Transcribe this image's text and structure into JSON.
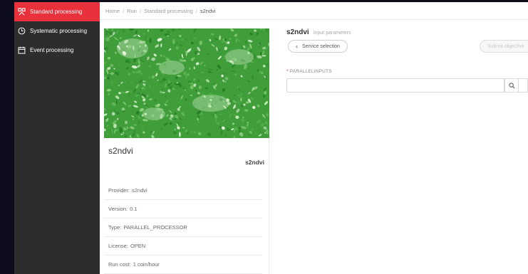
{
  "sidebar": {
    "items": [
      {
        "label": "Standard processing",
        "icon": "standard-processing-icon",
        "active": true
      },
      {
        "label": "Systematic processing",
        "icon": "clock-icon",
        "active": false
      },
      {
        "label": "Event processing",
        "icon": "calendar-icon",
        "active": false
      }
    ],
    "active_color": "#e8313b"
  },
  "breadcrumb": [
    "Home",
    "Run",
    "Standard processing",
    "s2ndvi"
  ],
  "breadcrumb_separator": "/",
  "card": {
    "title": "s2ndvi",
    "subtitle": "s2ndvi",
    "meta": [
      {
        "key": "Provider:",
        "value": "s2ndvi"
      },
      {
        "key": "Version:",
        "value": "0.1"
      },
      {
        "key": "Type:",
        "value": "PARALLEL_PROCESSOR"
      },
      {
        "key": "License:",
        "value": "OPEN"
      },
      {
        "key": "Run cost:",
        "value": "1 coin/hour"
      }
    ]
  },
  "panel": {
    "title": "s2ndvi",
    "subtitle": "Input parameters",
    "back_label": "Service selection",
    "submit_label": "Submit objective",
    "field_label": "PARALLELINPUTS",
    "field_value": ""
  }
}
